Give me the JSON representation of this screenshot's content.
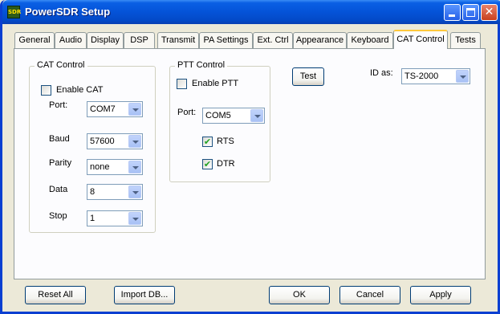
{
  "window": {
    "title": "PowerSDR Setup",
    "icon_text": "SDR",
    "buttons": [
      "minimize-icon",
      "maximize-icon",
      "close-icon"
    ]
  },
  "tabs": [
    {
      "label": "General"
    },
    {
      "label": "Audio"
    },
    {
      "label": "Display"
    },
    {
      "label": "DSP"
    },
    {
      "label": "Transmit"
    },
    {
      "label": "PA Settings"
    },
    {
      "label": "Ext. Ctrl"
    },
    {
      "label": "Appearance"
    },
    {
      "label": "Keyboard"
    },
    {
      "label": "CAT Control",
      "active": true
    },
    {
      "label": "Tests"
    }
  ],
  "cat_control": {
    "group_title": "CAT Control",
    "enable_label": "Enable CAT",
    "enable_checked": false,
    "port_label": "Port:",
    "port_value": "COM7",
    "baud_label": "Baud",
    "baud_value": "57600",
    "parity_label": "Parity",
    "parity_value": "none",
    "data_label": "Data",
    "data_value": "8",
    "stop_label": "Stop",
    "stop_value": "1"
  },
  "ptt_control": {
    "group_title": "PTT Control",
    "enable_label": "Enable PTT",
    "enable_checked": false,
    "port_label": "Port:",
    "port_value": "COM5",
    "rts_label": "RTS",
    "rts_checked": true,
    "dtr_label": "DTR",
    "dtr_checked": true
  },
  "test_button": "Test",
  "id_as": {
    "label": "ID as:",
    "value": "TS-2000"
  },
  "footer": {
    "reset_all": "Reset All",
    "import_db": "Import DB...",
    "ok": "OK",
    "cancel": "Cancel",
    "apply": "Apply"
  },
  "checkmark_glyph": "✔",
  "colors": {
    "titlebar": "#0453d8",
    "window_frame": "#0a3fd1",
    "dialog_bg": "#ece9d8",
    "active_tab_highlight": "#ffc83c",
    "check_color": "#21a121"
  }
}
